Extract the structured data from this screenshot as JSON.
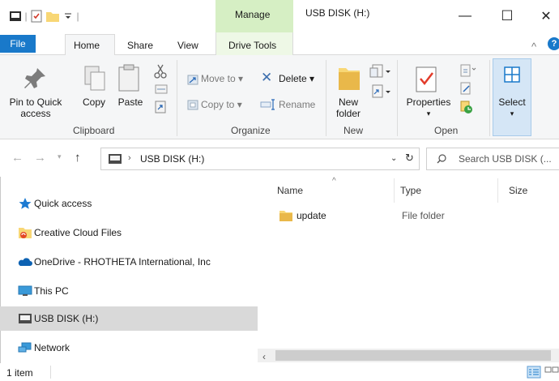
{
  "window": {
    "title": "USB DISK (H:)",
    "context_tab_group": "Manage",
    "minimize": "—",
    "maximize": "☐",
    "close": "✕"
  },
  "ribbon_tabs": {
    "file": "File",
    "home": "Home",
    "share": "Share",
    "view": "View",
    "drive_tools": "Drive Tools",
    "collapse": "^",
    "help": "?"
  },
  "clipboard": {
    "group": "Clipboard",
    "pin_line1": "Pin to Quick",
    "pin_line2": "access",
    "copy": "Copy",
    "paste": "Paste"
  },
  "organize": {
    "group": "Organize",
    "move_to": "Move to",
    "copy_to": "Copy to",
    "delete": "Delete",
    "rename": "Rename"
  },
  "new_group": {
    "group": "New",
    "new_folder_line1": "New",
    "new_folder_line2": "folder"
  },
  "open_group": {
    "group": "Open",
    "properties": "Properties"
  },
  "select_group": {
    "select": "Select"
  },
  "address": {
    "path": "USB DISK (H:)",
    "search_placeholder": "Search USB DISK (..."
  },
  "nav_pane": {
    "items": [
      {
        "label": "Quick access"
      },
      {
        "label": "Creative Cloud Files"
      },
      {
        "label": "OneDrive - RHOTHETA International, Inc"
      },
      {
        "label": "This PC"
      },
      {
        "label": "USB DISK (H:)"
      },
      {
        "label": "Network"
      }
    ]
  },
  "columns": {
    "name": "Name",
    "type": "Type",
    "size": "Size"
  },
  "files": [
    {
      "name": "update",
      "type": "File folder"
    }
  ],
  "status": {
    "count": "1 item"
  },
  "colors": {
    "accent": "#1979ca",
    "manage_tab": "#d6efc4",
    "selected_nav": "#d9d9d9",
    "folder": "#f8d775"
  }
}
